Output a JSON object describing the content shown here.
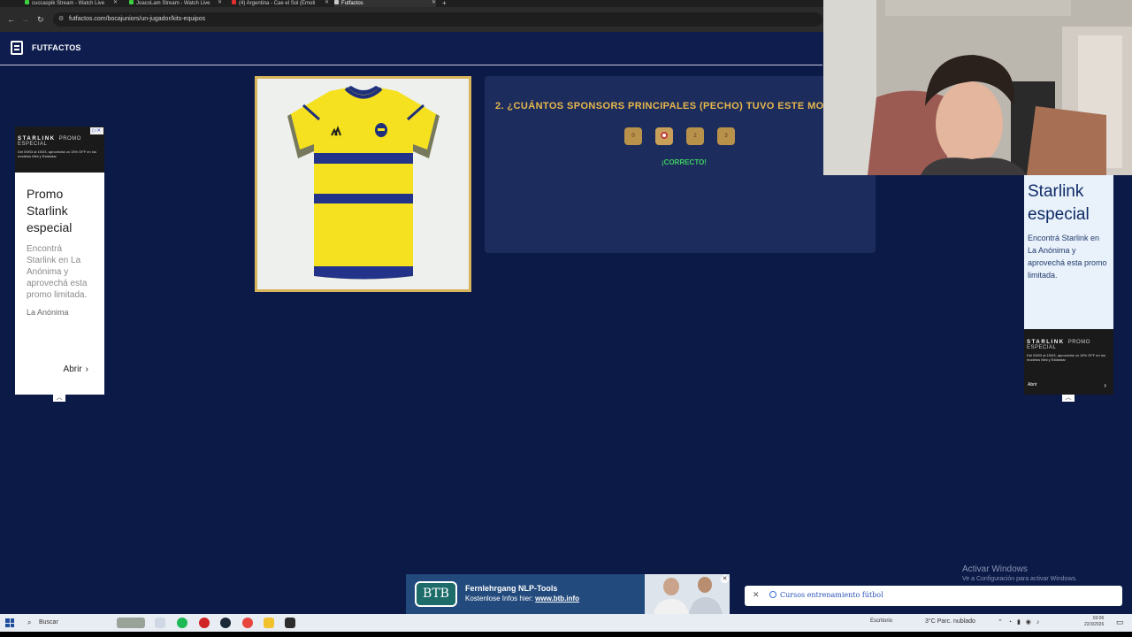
{
  "browser": {
    "tabs": [
      {
        "label": "cuccaspik Stream - Watch Live",
        "fav": "#3ecf3e"
      },
      {
        "label": "JoacoLam Stream - Watch Live",
        "fav": "#3ecf3e"
      },
      {
        "label": "(4) Argentina - Cae el Sol (Emoti",
        "fav": "#e03030"
      },
      {
        "label": "Futfactos",
        "fav": "#c9c9c9"
      }
    ],
    "url": "futfactos.com/bocajuniors/un-jugador/kits-equipos"
  },
  "site": {
    "brand": "FUTFACTOS"
  },
  "quiz": {
    "question": "2. ¿CUÁNTOS SPONSORS PRINCIPALES (PECHO) TUVO ESTE MODELO?",
    "options": [
      "0",
      "1",
      "2",
      "3"
    ],
    "selected_index": 1,
    "feedback": "¡CORRECTO!"
  },
  "ad_left": {
    "banner_brand": "STARLINK",
    "banner_tag": "PROMO ESPECIAL",
    "banner_fine": "Del 09/03 al 15/03, aprovechá un 15% OFF en los modelos Mini y Estándar",
    "headline": "Promo Starlink especial",
    "body": "Encontrá Starlink en La Anónima y aprovechá esta promo limitada.",
    "advertiser": "La Anónima",
    "cta": "Abrir"
  },
  "ad_right": {
    "headline": "Starlink especial",
    "body": "Encontrá Starlink en La Anónima y aprovechá esta promo limitada.",
    "banner_brand": "STARLINK",
    "banner_tag": "PROMO ESPECIAL",
    "banner_fine": "Del 09/03 al 15/03, aprovechá un 15% OFF en los modelos Mini y Estándar",
    "cta": "Abrir"
  },
  "bottom_ad": {
    "logo": "BTB",
    "title": "Fernlehrgang NLP-Tools",
    "line_prefix": "Kostenlose Infos hier: ",
    "line_link": "www.btb.info"
  },
  "suggestion": {
    "text": "Cursos entrenamiento fútbol"
  },
  "watermark": {
    "title": "Activar Windows",
    "subtitle": "Ve a Configuración para activar Windows."
  },
  "taskbar": {
    "search": "Buscar",
    "desktop": "Escritorio",
    "weather": "3°C  Parc. nublado",
    "time": "03:06",
    "date": "22/3/2026"
  },
  "colors": {
    "page_bg": "#0b1a47",
    "accent_gold": "#e7b84b",
    "correct_green": "#3fcf63"
  }
}
